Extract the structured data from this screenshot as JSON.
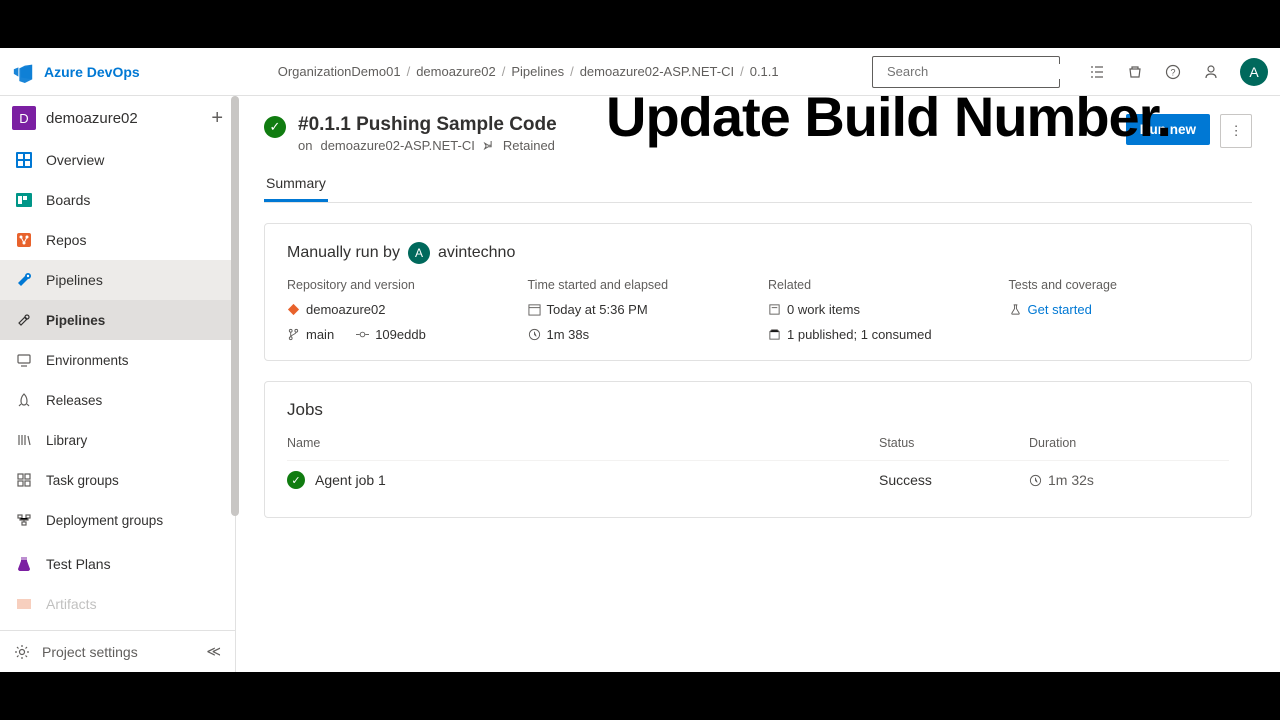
{
  "brand": "Azure DevOps",
  "breadcrumb": [
    "OrganizationDemo01",
    "demoazure02",
    "Pipelines",
    "demoazure02-ASP.NET-CI",
    "0.1.1"
  ],
  "search": {
    "placeholder": "Search"
  },
  "avatar_initial": "A",
  "project": {
    "initial": "D",
    "name": "demoazure02"
  },
  "sidebar": {
    "items": [
      {
        "label": "Overview"
      },
      {
        "label": "Boards"
      },
      {
        "label": "Repos"
      },
      {
        "label": "Pipelines"
      }
    ],
    "sub": [
      {
        "label": "Pipelines"
      },
      {
        "label": "Environments"
      },
      {
        "label": "Releases"
      },
      {
        "label": "Library"
      },
      {
        "label": "Task groups"
      },
      {
        "label": "Deployment groups"
      }
    ],
    "items2": [
      {
        "label": "Test Plans"
      },
      {
        "label": "Artifacts"
      }
    ],
    "footer": "Project settings"
  },
  "build": {
    "title": "#0.1.1 Pushing Sample Code",
    "subtitle_prefix": "on",
    "pipeline": "demoazure02-ASP.NET-CI",
    "retained": "Retained",
    "run_new": "Run new"
  },
  "tabs": [
    "Summary"
  ],
  "summary": {
    "ran_by_prefix": "Manually run by",
    "ran_by_user": "avintechno",
    "repo_label": "Repository and version",
    "repo_name": "demoazure02",
    "branch": "main",
    "commit": "109eddb",
    "time_label": "Time started and elapsed",
    "time_start": "Today at 5:36 PM",
    "elapsed": "1m 38s",
    "related_label": "Related",
    "work_items": "0 work items",
    "artifacts": "1 published; 1 consumed",
    "tests_label": "Tests and coverage",
    "tests_link": "Get started"
  },
  "jobs": {
    "title": "Jobs",
    "columns": {
      "name": "Name",
      "status": "Status",
      "duration": "Duration"
    },
    "rows": [
      {
        "name": "Agent job 1",
        "status": "Success",
        "duration": "1m 32s"
      }
    ]
  },
  "overlay": "Update Build Number."
}
